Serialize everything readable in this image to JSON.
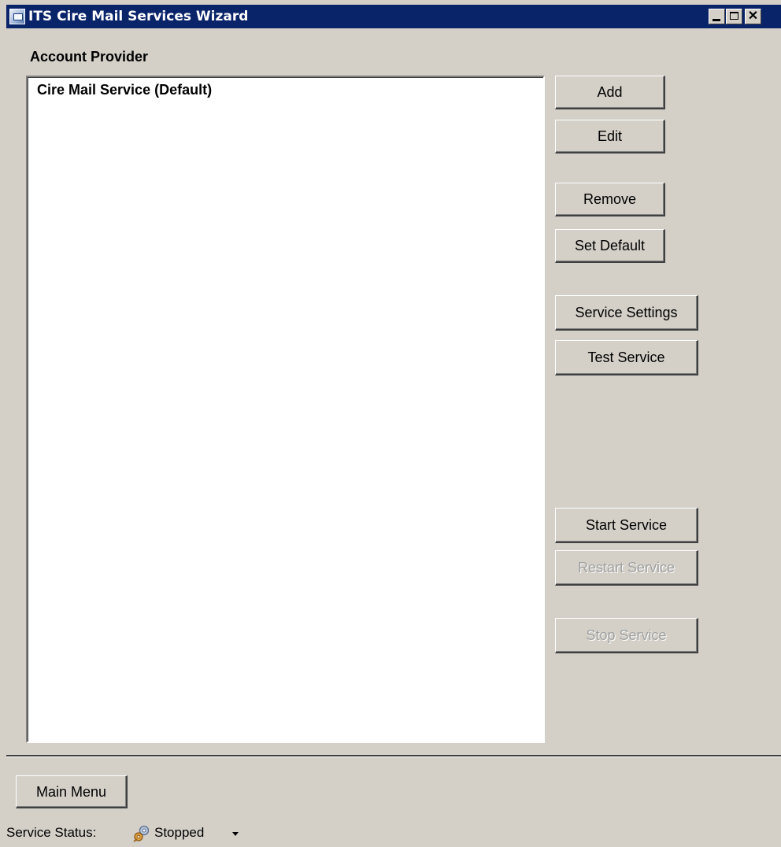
{
  "window": {
    "title": "ITS Cire Mail Services Wizard",
    "app_icon": "mail-wizard-icon",
    "controls": [
      "minimize-icon",
      "maximize-icon",
      "close-icon"
    ],
    "close_glyph": "✕"
  },
  "account_provider": {
    "label": "Account Provider",
    "items": [
      "Cire Mail Service (Default)"
    ]
  },
  "buttons": {
    "add": "Add",
    "edit": "Edit",
    "remove": "Remove",
    "set_default": "Set Default",
    "service_settings": "Service Settings",
    "test_service": "Test Service",
    "start_service": "Start Service",
    "restart_service": "Restart Service",
    "stop_service": "Stop Service",
    "main_menu": "Main Menu"
  },
  "disabled_buttons": [
    "restart_service",
    "stop_service"
  ],
  "status": {
    "label": "Service Status:",
    "value": "Stopped",
    "icon": "gears-icon"
  },
  "colors": {
    "titlebar": "#0a246a",
    "face": "#d4d0c8",
    "disabled_text": "#a0a0a0"
  }
}
